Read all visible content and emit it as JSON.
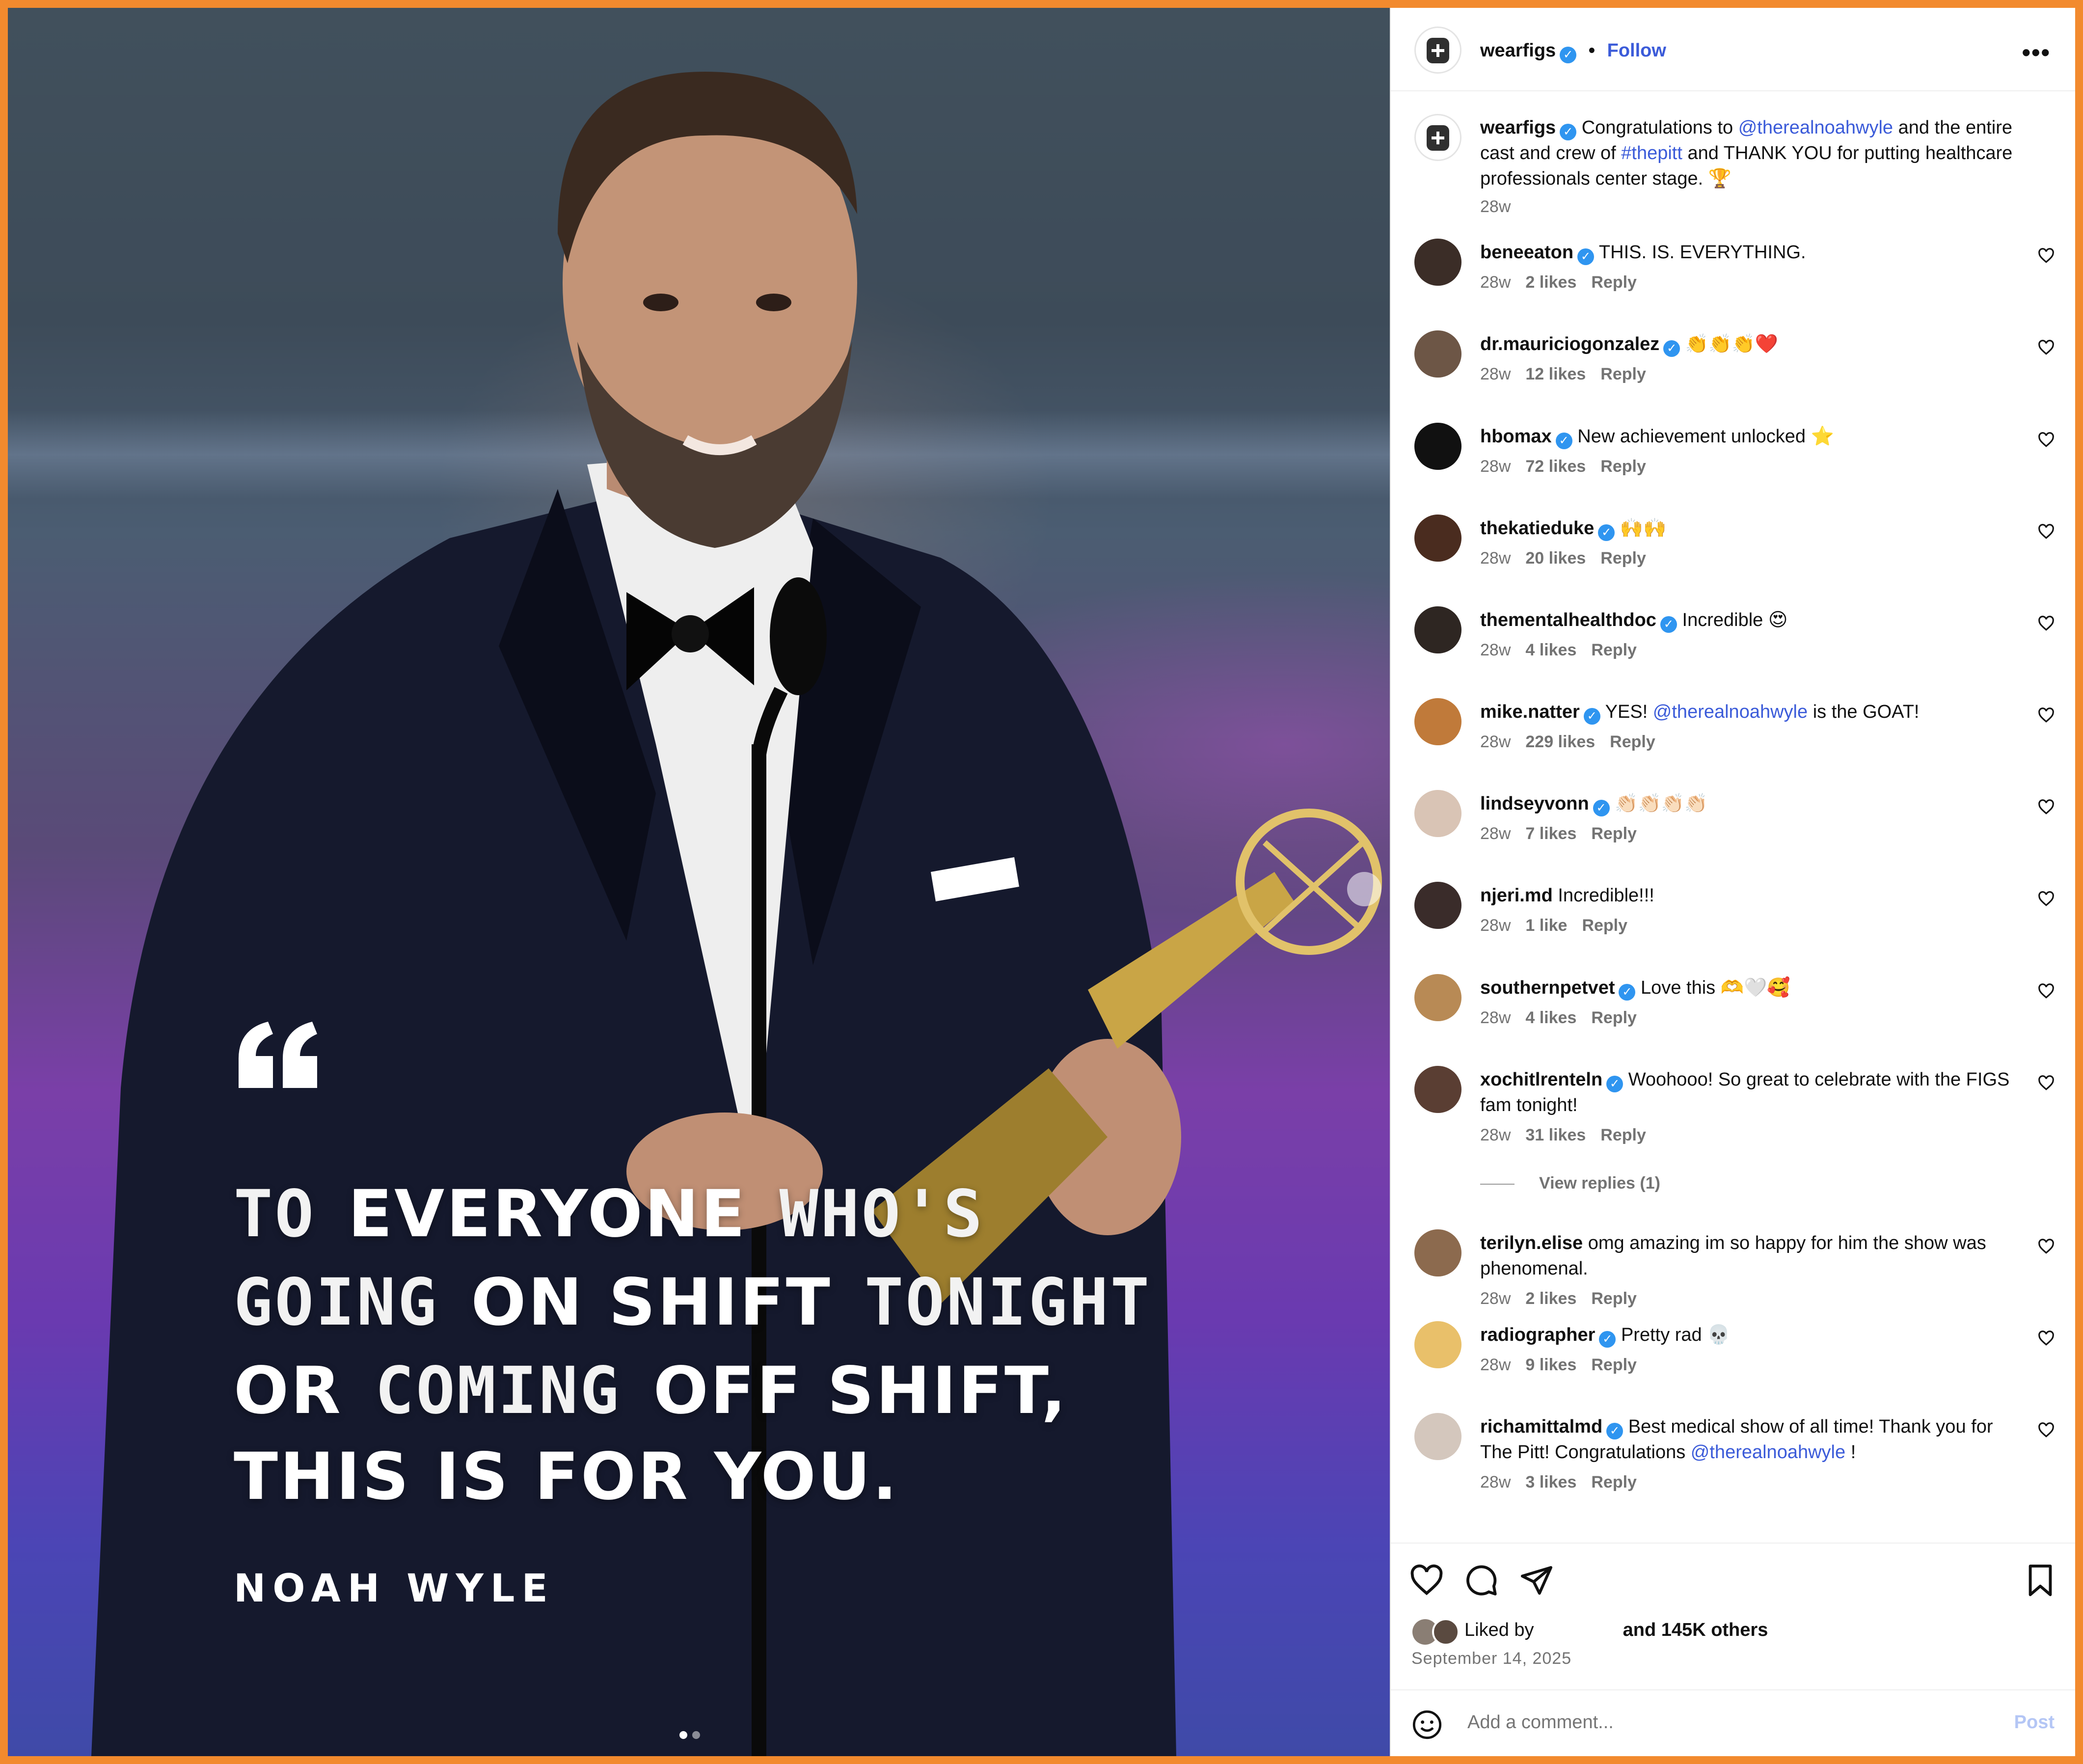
{
  "post": {
    "username": "wearfigs",
    "follow_label": "Follow",
    "separator": "•",
    "more_label": "•••",
    "caption": {
      "username": "wearfigs",
      "text_before": "Congratulations to",
      "mention": "@therealnoahwyle",
      "text_mid": "and the entire cast and crew of",
      "hashtag": "#thepitt",
      "text_after": "and THANK YOU for putting healthcare professionals center stage. 🏆",
      "time": "28w"
    }
  },
  "media": {
    "quote_mark": "“",
    "lines": [
      [
        "TO",
        "EVERYONE",
        "WHO'S"
      ],
      [
        "GOING",
        "ON SHIFT",
        "TONIGHT"
      ],
      [
        "OR",
        "COMING",
        "OFF SHIFT,"
      ],
      [
        "THIS IS FOR YOU."
      ]
    ],
    "attribution": "NOAH WYLE",
    "carousel_index": 1,
    "carousel_total": 2
  },
  "comments": [
    {
      "user": "beneeaton",
      "verified": true,
      "text": "THIS. IS. EVERYTHING.",
      "time": "28w",
      "likes": "2 likes",
      "reply": "Reply"
    },
    {
      "user": "dr.mauriciogonzalez",
      "verified": true,
      "text": "👏👏👏❤️",
      "time": "28w",
      "likes": "12 likes",
      "reply": "Reply"
    },
    {
      "user": "hbomax",
      "verified": true,
      "text": "New achievement unlocked ⭐",
      "time": "28w",
      "likes": "72 likes",
      "reply": "Reply"
    },
    {
      "user": "thekatieduke",
      "verified": true,
      "text": "🙌🙌",
      "time": "28w",
      "likes": "20 likes",
      "reply": "Reply"
    },
    {
      "user": "thementalhealthdoc",
      "verified": true,
      "text": "Incredible 😍",
      "time": "28w",
      "likes": "4 likes",
      "reply": "Reply"
    },
    {
      "user": "mike.natter",
      "verified": true,
      "text_before": "YES!",
      "mention": "@therealnoahwyle",
      "text_after": "is the GOAT!",
      "time": "28w",
      "likes": "229 likes",
      "reply": "Reply"
    },
    {
      "user": "lindseyvonn",
      "verified": true,
      "text": "👏🏻👏🏻👏🏻👏🏻",
      "time": "28w",
      "likes": "7 likes",
      "reply": "Reply"
    },
    {
      "user": "njeri.md",
      "verified": false,
      "text": "Incredible!!!",
      "time": "28w",
      "likes": "1 like",
      "reply": "Reply"
    },
    {
      "user": "southernpetvet",
      "verified": true,
      "text": "Love this 🫶🤍🥰",
      "time": "28w",
      "likes": "4 likes",
      "reply": "Reply"
    },
    {
      "user": "xochitlrenteln",
      "verified": true,
      "text": "Woohooo! So great to celebrate with the FIGS fam tonight!",
      "time": "28w",
      "likes": "31 likes",
      "reply": "Reply",
      "view_replies": "View replies (1)"
    },
    {
      "user": "terilyn.elise",
      "verified": false,
      "text": "omg amazing im so happy for him the show was phenomenal.",
      "time": "28w",
      "likes": "2 likes",
      "reply": "Reply"
    },
    {
      "user": "radiographer",
      "verified": true,
      "text": "Pretty rad 💀",
      "time": "28w",
      "likes": "9 likes",
      "reply": "Reply"
    },
    {
      "user": "richamittalmd",
      "verified": true,
      "text_before": "Best medical show of all time! Thank you for The Pitt! Congratulations",
      "mention": "@therealnoahwyle",
      "text_after": "!",
      "time": "28w",
      "likes": "3 likes",
      "reply": "Reply"
    }
  ],
  "footer": {
    "liked_by_label": "Liked by",
    "others": "and 145K others",
    "date": "September 14, 2025",
    "add_comment_placeholder": "Add a comment...",
    "post_label": "Post"
  },
  "colors": {
    "frame": "#f28a2e",
    "link": "#3b5bd9",
    "verified": "#2f95f0",
    "muted": "#737373"
  },
  "icons": [
    "heart-icon",
    "comment-icon",
    "share-icon",
    "bookmark-icon",
    "emoji-icon",
    "verified-icon",
    "more-icon"
  ]
}
